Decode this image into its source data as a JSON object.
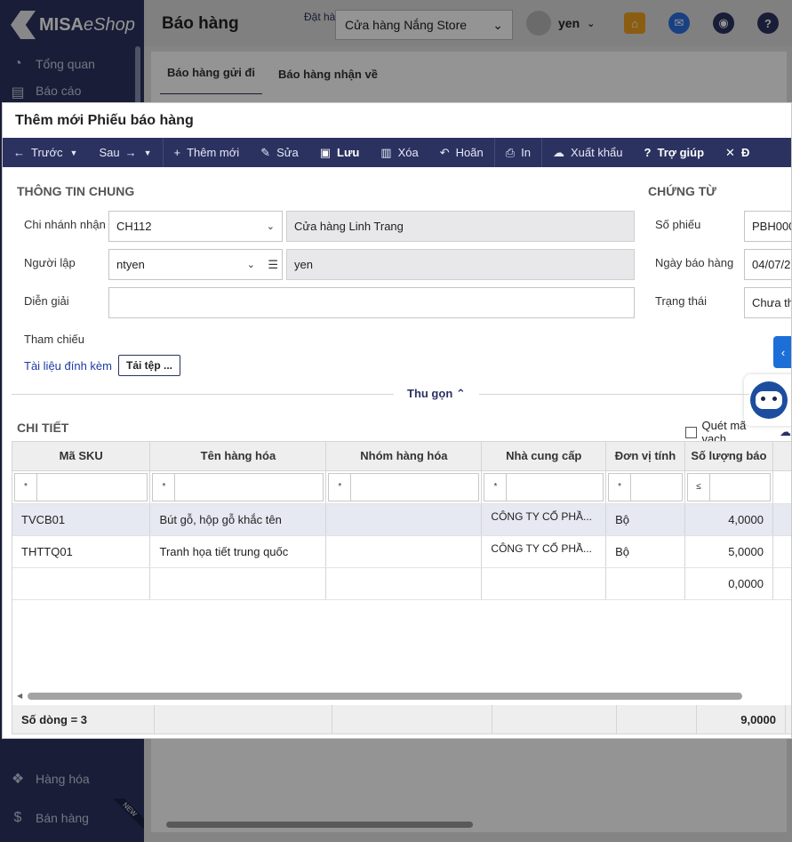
{
  "app": {
    "logo_main": "MISA",
    "logo_sub": "eShop",
    "page_title": "Báo hàng",
    "store_label": "Đặt hà",
    "store_value": "Cửa hàng Nắng Store",
    "user_name": "yen"
  },
  "sidebar": {
    "items": [
      {
        "label": "Tổng quan",
        "icon": "dashboard-icon"
      },
      {
        "label": "Báo cáo",
        "icon": "report-icon"
      },
      {
        "label": "Hàng hóa",
        "icon": "boxes-icon"
      },
      {
        "label": "Bán hàng",
        "icon": "sales-icon",
        "badge": "NEW"
      }
    ]
  },
  "bg_tabs": [
    "Báo hàng gửi đi",
    "Báo hàng nhận về"
  ],
  "dialog": {
    "title": "Thêm mới Phiếu báo hàng",
    "toolbar": {
      "prev": "Trước",
      "next": "Sau",
      "add": "Thêm mới",
      "edit": "Sửa",
      "save": "Lưu",
      "delete": "Xóa",
      "undo": "Hoãn",
      "print": "In",
      "export": "Xuất khẩu",
      "help": "Trợ giúp",
      "close": "Đ"
    },
    "general": {
      "heading": "THÔNG TIN CHUNG",
      "branch_label": "Chi nhánh nhận",
      "branch_code": "CH112",
      "branch_name": "Cửa hàng Linh Trang",
      "creator_label": "Người lập",
      "creator_code": "ntyen",
      "creator_name": "yen",
      "desc_label": "Diễn giải",
      "desc_value": "",
      "ref_label": "Tham chiếu",
      "attach_label": "Tài liệu đính kèm",
      "attach_button": "Tải tệp ..."
    },
    "voucher": {
      "heading": "CHỨNG TỪ",
      "number_label": "Số phiếu",
      "number_value": "PBH000",
      "date_label": "Ngày báo hàng",
      "date_value": "04/07/2",
      "status_label": "Trạng thái",
      "status_value": "Chưa th"
    },
    "collapse_label": "Thu gọn",
    "detail": {
      "heading": "CHI TIẾT",
      "scan_label": "Quét mã vạch",
      "columns": [
        "Mã SKU",
        "Tên hàng hóa",
        "Nhóm hàng hóa",
        "Nhà cung cấp",
        "Đơn vị tính",
        "Số lượng báo"
      ],
      "filter_ops": [
        "*",
        "*",
        "*",
        "*",
        "*",
        "≤"
      ],
      "rows": [
        {
          "sku": "TVCB01",
          "name": "Bút gỗ, hộp gỗ khắc tên",
          "group": "",
          "supplier": "CÔNG TY CỔ PHẦ...",
          "unit": "Bộ",
          "qty": "4,0000"
        },
        {
          "sku": "THTTQ01",
          "name": "Tranh họa tiết trung quốc",
          "group": "",
          "supplier": "CÔNG TY CỔ PHẦ...",
          "unit": "Bộ",
          "qty": "5,0000"
        },
        {
          "sku": "",
          "name": "",
          "group": "",
          "supplier": "",
          "unit": "",
          "qty": "0,0000"
        }
      ],
      "footer_count": "Số dòng = 3",
      "footer_total": "9,0000"
    }
  },
  "colors": {
    "brand": "#2b3260",
    "link": "#1e3aa8",
    "accent_blue": "#1d6fd8"
  }
}
